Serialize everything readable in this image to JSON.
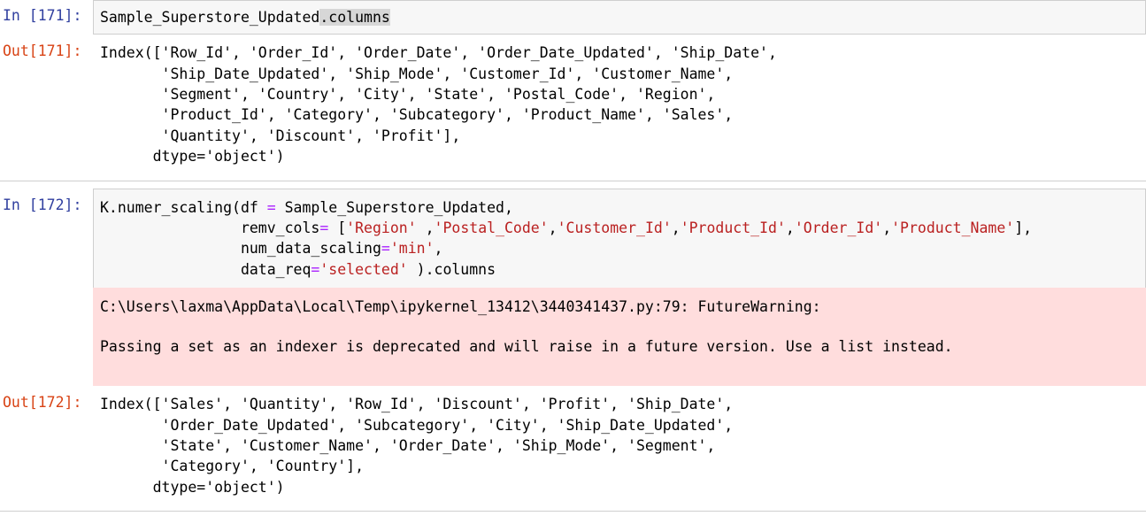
{
  "cell171": {
    "in_prompt": "In [171]:",
    "code_object": "Sample_Superstore_Updated",
    "code_attr": ".columns",
    "out_prompt": "Out[171]:",
    "output_lines": [
      "Index(['Row_Id', 'Order_Id', 'Order_Date', 'Order_Date_Updated', 'Ship_Date',",
      "       'Ship_Date_Updated', 'Ship_Mode', 'Customer_Id', 'Customer_Name',",
      "       'Segment', 'Country', 'City', 'State', 'Postal_Code', 'Region',",
      "       'Product_Id', 'Category', 'Subcategory', 'Product_Name', 'Sales',",
      "       'Quantity', 'Discount', 'Profit'],",
      "      dtype='object')"
    ]
  },
  "cell172": {
    "in_prompt": "In [172]:",
    "code": {
      "l1_a": "K.numer_scaling(df ",
      "l1_eq": "=",
      "l1_b": " Sample_Superstore_Updated,",
      "l2_a": "                remv_cols",
      "l2_eq": "=",
      "l2_b": " [",
      "l2_s1": "'Region'",
      "l2_c1": " ,",
      "l2_s2": "'Postal_Code'",
      "l2_c2": ",",
      "l2_s3": "'Customer_Id'",
      "l2_c3": ",",
      "l2_s4": "'Product_Id'",
      "l2_c4": ",",
      "l2_s5": "'Order_Id'",
      "l2_c5": ",",
      "l2_s6": "'Product_Name'",
      "l2_end": "],",
      "l3_a": "                num_data_scaling",
      "l3_eq": "=",
      "l3_s": "'min'",
      "l3_end": ",",
      "l4_a": "                data_req",
      "l4_eq": "=",
      "l4_s": "'selected'",
      "l4_end": " ).columns"
    },
    "warning_line1": "C:\\Users\\laxma\\AppData\\Local\\Temp\\ipykernel_13412\\3440341437.py:79: FutureWarning:",
    "warning_line2": "Passing a set as an indexer is deprecated and will raise in a future version. Use a list instead.",
    "out_prompt": "Out[172]:",
    "output_lines": [
      "Index(['Sales', 'Quantity', 'Row_Id', 'Discount', 'Profit', 'Ship_Date',",
      "       'Order_Date_Updated', 'Subcategory', 'City', 'Ship_Date_Updated',",
      "       'State', 'Customer_Name', 'Order_Date', 'Ship_Mode', 'Segment',",
      "       'Category', 'Country'],",
      "      dtype='object')"
    ]
  }
}
